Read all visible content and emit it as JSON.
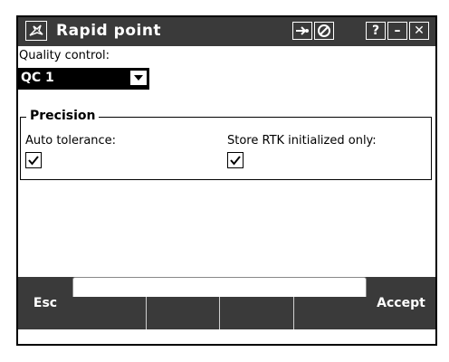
{
  "window": {
    "title": "Rapid point",
    "buttons": {
      "help": "?",
      "minimize": "–",
      "close": "✕"
    }
  },
  "form": {
    "quality_control_label": "Quality control:",
    "quality_control_value": "QC 1",
    "precision_group": "Precision",
    "auto_tolerance_label": "Auto tolerance:",
    "auto_tolerance_checked": true,
    "store_rtk_label": "Store RTK initialized only:",
    "store_rtk_checked": true
  },
  "softkeys": {
    "left": "Esc",
    "right": "Accept"
  },
  "colors": {
    "bar_background": "#3a3a3a",
    "text_on_bar": "#ffffff"
  }
}
